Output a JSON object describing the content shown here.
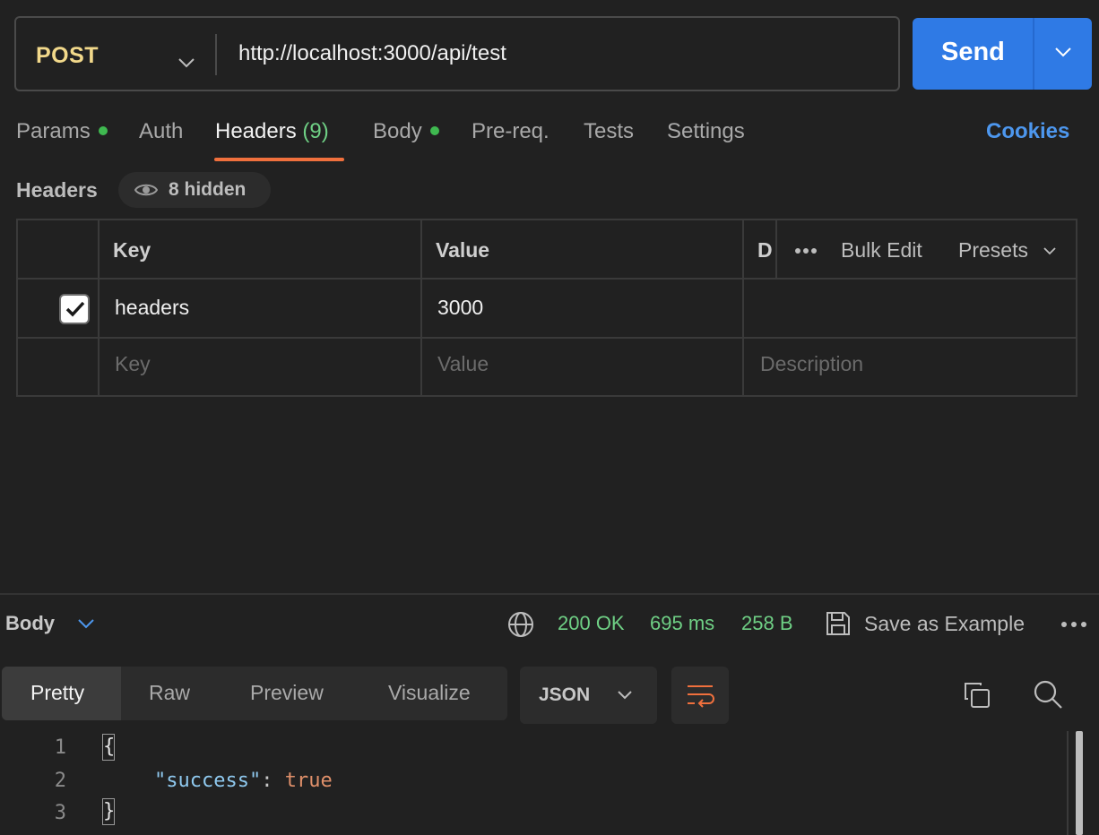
{
  "request": {
    "method": "POST",
    "url": "http://localhost:3000/api/test",
    "send_label": "Send"
  },
  "tabs": [
    {
      "label": "Params",
      "dot": true
    },
    {
      "label": "Auth"
    },
    {
      "label": "Headers",
      "count": "(9)",
      "active": true
    },
    {
      "label": "Body",
      "dot": true
    },
    {
      "label": "Pre-req."
    },
    {
      "label": "Tests"
    },
    {
      "label": "Settings"
    }
  ],
  "cookies_label": "Cookies",
  "headers_section": {
    "title": "Headers",
    "hidden_label": "8 hidden"
  },
  "table": {
    "columns": {
      "key": "Key",
      "value": "Value",
      "description": "D"
    },
    "tools": {
      "bulk_edit": "Bulk Edit",
      "presets": "Presets"
    },
    "rows": [
      {
        "checked": true,
        "key": "headers",
        "value": "3000",
        "description": ""
      }
    ],
    "placeholder": {
      "key": "Key",
      "value": "Value",
      "description": "Description"
    }
  },
  "response": {
    "body_label": "Body",
    "status": "200 OK",
    "time": "695 ms",
    "size": "258 B",
    "save_label": "Save as Example",
    "view_tabs": [
      "Pretty",
      "Raw",
      "Preview",
      "Visualize"
    ],
    "active_view": "Pretty",
    "format": "JSON",
    "code_lines": [
      {
        "num": "1",
        "open": "{"
      },
      {
        "num": "2",
        "key": "\"success\"",
        "colon": ":",
        "value": "true"
      },
      {
        "num": "3",
        "close": "}"
      }
    ]
  },
  "colors": {
    "method": "#f2d98b",
    "send": "#2f7ae5",
    "accent_underline": "#f0703d",
    "status_green": "#6fd085",
    "cookies_blue": "#4d97ee"
  }
}
